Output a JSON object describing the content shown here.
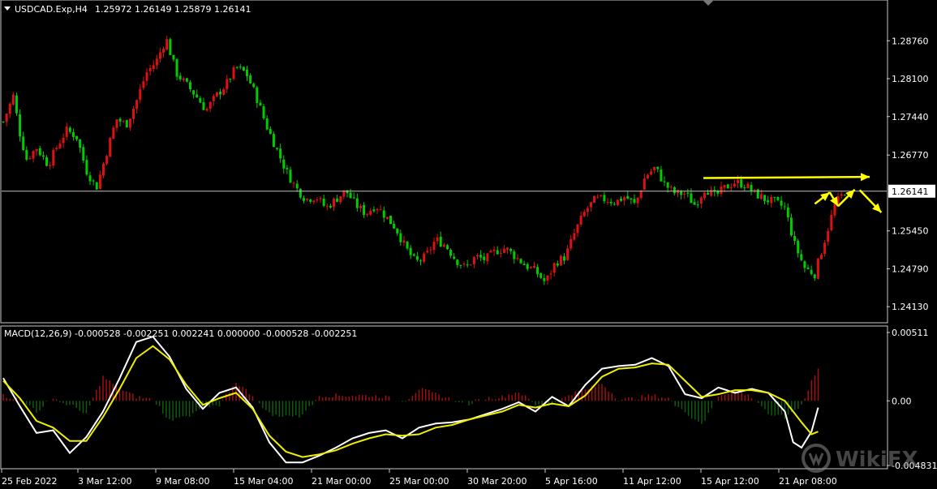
{
  "header": {
    "symbol": "USDCAD.Exp,H4",
    "ohlc": "1.25972 1.26149 1.25879 1.26141"
  },
  "colors": {
    "background": "#000000",
    "bull": "#dd1111",
    "bear": "#00cc00",
    "price_line": "#c0c0c0",
    "macd_line": "#ffffff",
    "signal_line": "#eeee00",
    "arrows": "#ffff00",
    "hist_pos": "#a01010",
    "hist_neg": "#0f5a0f"
  },
  "watermark": {
    "text": "WikiFX",
    "icon": "wikifx-logo-icon"
  },
  "chart_data": [
    {
      "type": "candlestick",
      "title": "USDCAD.Exp,H4",
      "ylim": [
        1.2385,
        1.2947
      ],
      "yticks": [
        "1.28760",
        "1.28100",
        "1.27440",
        "1.26770",
        "1.26141",
        "1.25450",
        "1.24790",
        "1.24130"
      ],
      "current_price": "1.26141",
      "x_tick_labels": [
        "25 Feb 2022",
        "3 Mar 12:00",
        "9 Mar 08:00",
        "15 Mar 04:00",
        "21 Mar 00:00",
        "25 Mar 00:00",
        "30 Mar 20:00",
        "5 Apr 16:00",
        "11 Apr 12:00",
        "15 Apr 12:00",
        "21 Apr 08:00"
      ],
      "close_path": [
        [
          0,
          1.2735
        ],
        [
          6,
          1.278
        ],
        [
          10,
          1.2715
        ],
        [
          14,
          1.267
        ],
        [
          20,
          1.269
        ],
        [
          27,
          1.266
        ],
        [
          32,
          1.269
        ],
        [
          38,
          1.272
        ],
        [
          44,
          1.271
        ],
        [
          50,
          1.265
        ],
        [
          56,
          1.262
        ],
        [
          62,
          1.268
        ],
        [
          68,
          1.274
        ],
        [
          74,
          1.273
        ],
        [
          80,
          1.277
        ],
        [
          86,
          1.282
        ],
        [
          92,
          1.284
        ],
        [
          98,
          1.288
        ],
        [
          104,
          1.282
        ],
        [
          110,
          1.28
        ],
        [
          116,
          1.278
        ],
        [
          122,
          1.2755
        ],
        [
          128,
          1.278
        ],
        [
          134,
          1.28
        ],
        [
          140,
          1.283
        ],
        [
          146,
          1.282
        ],
        [
          152,
          1.278
        ],
        [
          158,
          1.273
        ],
        [
          164,
          1.269
        ],
        [
          170,
          1.265
        ],
        [
          176,
          1.262
        ],
        [
          182,
          1.26
        ],
        [
          188,
          1.2605
        ],
        [
          194,
          1.2585
        ],
        [
          200,
          1.26
        ],
        [
          206,
          1.2615
        ],
        [
          212,
          1.259
        ],
        [
          218,
          1.2575
        ],
        [
          224,
          1.259
        ],
        [
          230,
          1.257
        ],
        [
          236,
          1.255
        ],
        [
          242,
          1.2515
        ],
        [
          248,
          1.249
        ],
        [
          254,
          1.25
        ],
        [
          260,
          1.253
        ],
        [
          266,
          1.252
        ],
        [
          272,
          1.2495
        ],
        [
          278,
          1.248
        ],
        [
          284,
          1.25
        ],
        [
          290,
          1.2495
        ],
        [
          296,
          1.251
        ],
        [
          302,
          1.2515
        ],
        [
          308,
          1.25
        ],
        [
          314,
          1.2485
        ],
        [
          320,
          1.2475
        ],
        [
          326,
          1.2455
        ],
        [
          332,
          1.249
        ],
        [
          338,
          1.25
        ],
        [
          344,
          1.2545
        ],
        [
          350,
          1.258
        ],
        [
          356,
          1.26
        ],
        [
          362,
          1.26
        ],
        [
          368,
          1.2595
        ],
        [
          374,
          1.2605
        ],
        [
          380,
          1.259
        ],
        [
          386,
          1.264
        ],
        [
          392,
          1.2655
        ],
        [
          398,
          1.2625
        ],
        [
          404,
          1.261
        ],
        [
          410,
          1.261
        ],
        [
          416,
          1.259
        ],
        [
          422,
          1.262
        ],
        [
          428,
          1.2605
        ],
        [
          434,
          1.262
        ],
        [
          440,
          1.263
        ],
        [
          446,
          1.2625
        ],
        [
          452,
          1.261
        ],
        [
          458,
          1.26
        ],
        [
          464,
          1.2595
        ],
        [
          470,
          1.2585
        ],
        [
          476,
          1.252
        ],
        [
          482,
          1.248
        ],
        [
          488,
          1.247
        ],
        [
          494,
          1.253
        ],
        [
          500,
          1.259
        ],
        [
          506,
          1.2614
        ]
      ],
      "candle_count": 253,
      "annotations": [
        {
          "type": "arrow",
          "desc": "horizontal resistance",
          "from": [
            421,
            1.2637
          ],
          "to": [
            521,
            1.2639
          ]
        },
        {
          "type": "arrow",
          "from": [
            488,
            1.2592
          ],
          "to": [
            497,
            1.2612
          ]
        },
        {
          "type": "arrow",
          "from": [
            497,
            1.2612
          ],
          "to": [
            502,
            1.2588
          ]
        },
        {
          "type": "arrow",
          "from": [
            502,
            1.2588
          ],
          "to": [
            512,
            1.2617
          ]
        },
        {
          "type": "arrow",
          "from": [
            515,
            1.2616
          ],
          "to": [
            528,
            1.2577
          ]
        }
      ]
    },
    {
      "type": "line+histogram",
      "title": "MACD(12,26,9) -0.000528 -0.002251 0.002241 0.000000 -0.000528 -0.002251",
      "ylim": [
        -0.004831,
        0.00511
      ],
      "yticks": [
        "0.00511",
        "0.00",
        "-0.004831"
      ],
      "series": [
        {
          "name": "",
          "style": "histogram",
          "points": [
            [
              0,
              0.0004
            ],
            [
              10,
              0.0001
            ],
            [
              20,
              -0.0008
            ],
            [
              30,
              0.0002
            ],
            [
              40,
              -0.0003
            ],
            [
              50,
              -0.0009
            ],
            [
              60,
              0.0018
            ],
            [
              70,
              0.0009
            ],
            [
              80,
              0.0003
            ],
            [
              90,
              0.0001
            ],
            [
              100,
              -0.0015
            ],
            [
              110,
              -0.0012
            ],
            [
              120,
              -0.0004
            ],
            [
              130,
              -0.0003
            ],
            [
              140,
              0.0014
            ],
            [
              150,
              0.0004
            ],
            [
              160,
              -0.001
            ],
            [
              170,
              -0.0012
            ],
            [
              180,
              -0.0011
            ],
            [
              190,
              0.0004
            ],
            [
              200,
              0.0004
            ],
            [
              210,
              0.0004
            ],
            [
              220,
              0.0004
            ],
            [
              230,
              0.0003
            ],
            [
              240,
              -0.0002
            ],
            [
              250,
              0.0009
            ],
            [
              260,
              0.0005
            ],
            [
              270,
              0.0001
            ],
            [
              280,
              -0.0002
            ],
            [
              290,
              0.0002
            ],
            [
              300,
              0.0003
            ],
            [
              310,
              0.0007
            ],
            [
              320,
              -0.0003
            ],
            [
              330,
              -0.0004
            ],
            [
              340,
              0.0005
            ],
            [
              350,
              0.0008
            ],
            [
              360,
              0.0013
            ],
            [
              370,
              0.0001
            ],
            [
              380,
              0.0002
            ],
            [
              390,
              0.0004
            ],
            [
              400,
              0.0002
            ],
            [
              410,
              -0.001
            ],
            [
              420,
              -0.0018
            ],
            [
              430,
              0.0004
            ],
            [
              440,
              0.0008
            ],
            [
              450,
              0.0003
            ],
            [
              460,
              -0.0009
            ],
            [
              470,
              -0.0012
            ],
            [
              480,
              -0.0004
            ],
            [
              486,
              0.0015
            ],
            [
              490,
              0.0024
            ]
          ]
        },
        {
          "name": "",
          "style": "line",
          "points": [
            [
              0,
              0.0017
            ],
            [
              10,
              -0.0004
            ],
            [
              20,
              -0.0024
            ],
            [
              30,
              -0.0022
            ],
            [
              40,
              -0.0039
            ],
            [
              50,
              -0.0027
            ],
            [
              60,
              -0.0008
            ],
            [
              70,
              0.0017
            ],
            [
              80,
              0.0044
            ],
            [
              90,
              0.0048
            ],
            [
              100,
              0.0033
            ],
            [
              110,
              0.0009
            ],
            [
              120,
              -0.0006
            ],
            [
              130,
              0.0006
            ],
            [
              140,
              0.001
            ],
            [
              150,
              -0.0005
            ],
            [
              160,
              -0.0031
            ],
            [
              170,
              -0.0046
            ],
            [
              180,
              -0.0046
            ],
            [
              190,
              -0.0041
            ],
            [
              200,
              -0.0035
            ],
            [
              210,
              -0.0028
            ],
            [
              220,
              -0.0024
            ],
            [
              230,
              -0.0022
            ],
            [
              240,
              -0.0028
            ],
            [
              250,
              -0.002
            ],
            [
              260,
              -0.0017
            ],
            [
              270,
              -0.0016
            ],
            [
              280,
              -0.0014
            ],
            [
              290,
              -0.001
            ],
            [
              300,
              -0.0006
            ],
            [
              310,
              -0.0001
            ],
            [
              320,
              -0.0008
            ],
            [
              330,
              0.0003
            ],
            [
              340,
              -0.0004
            ],
            [
              350,
              0.0012
            ],
            [
              360,
              0.0024
            ],
            [
              370,
              0.0026
            ],
            [
              380,
              0.0027
            ],
            [
              390,
              0.0032
            ],
            [
              400,
              0.0026
            ],
            [
              410,
              0.0005
            ],
            [
              420,
              0.0002
            ],
            [
              430,
              0.001
            ],
            [
              440,
              0.0006
            ],
            [
              450,
              0.0009
            ],
            [
              460,
              0.0006
            ],
            [
              470,
              -0.0008
            ],
            [
              475,
              -0.0031
            ],
            [
              480,
              -0.0035
            ],
            [
              486,
              -0.0023
            ],
            [
              490,
              -0.0005
            ]
          ]
        },
        {
          "name": "",
          "style": "line",
          "points": [
            [
              0,
              0.0015
            ],
            [
              10,
              0.0002
            ],
            [
              20,
              -0.0015
            ],
            [
              30,
              -0.002
            ],
            [
              40,
              -0.003
            ],
            [
              50,
              -0.003
            ],
            [
              60,
              -0.0012
            ],
            [
              70,
              0.0009
            ],
            [
              80,
              0.0032
            ],
            [
              90,
              0.0041
            ],
            [
              100,
              0.0031
            ],
            [
              110,
              0.0012
            ],
            [
              120,
              -0.0003
            ],
            [
              130,
              0.0002
            ],
            [
              140,
              0.0006
            ],
            [
              150,
              -0.0006
            ],
            [
              160,
              -0.0026
            ],
            [
              170,
              -0.0038
            ],
            [
              180,
              -0.0042
            ],
            [
              190,
              -0.004
            ],
            [
              200,
              -0.0037
            ],
            [
              210,
              -0.0032
            ],
            [
              220,
              -0.0028
            ],
            [
              230,
              -0.0025
            ],
            [
              240,
              -0.0026
            ],
            [
              250,
              -0.0025
            ],
            [
              260,
              -0.002
            ],
            [
              270,
              -0.0018
            ],
            [
              280,
              -0.0014
            ],
            [
              290,
              -0.0011
            ],
            [
              300,
              -0.0008
            ],
            [
              310,
              -0.0003
            ],
            [
              320,
              -0.0005
            ],
            [
              330,
              -0.0002
            ],
            [
              340,
              -0.0004
            ],
            [
              350,
              0.0004
            ],
            [
              360,
              0.0018
            ],
            [
              370,
              0.0024
            ],
            [
              380,
              0.0025
            ],
            [
              390,
              0.0028
            ],
            [
              400,
              0.0027
            ],
            [
              410,
              0.0015
            ],
            [
              420,
              0.0003
            ],
            [
              430,
              0.0005
            ],
            [
              440,
              0.0008
            ],
            [
              450,
              0.0008
            ],
            [
              460,
              0.0006
            ],
            [
              470,
              0.0
            ],
            [
              480,
              -0.0016
            ],
            [
              486,
              -0.0025
            ],
            [
              490,
              -0.0023
            ]
          ]
        }
      ]
    }
  ]
}
